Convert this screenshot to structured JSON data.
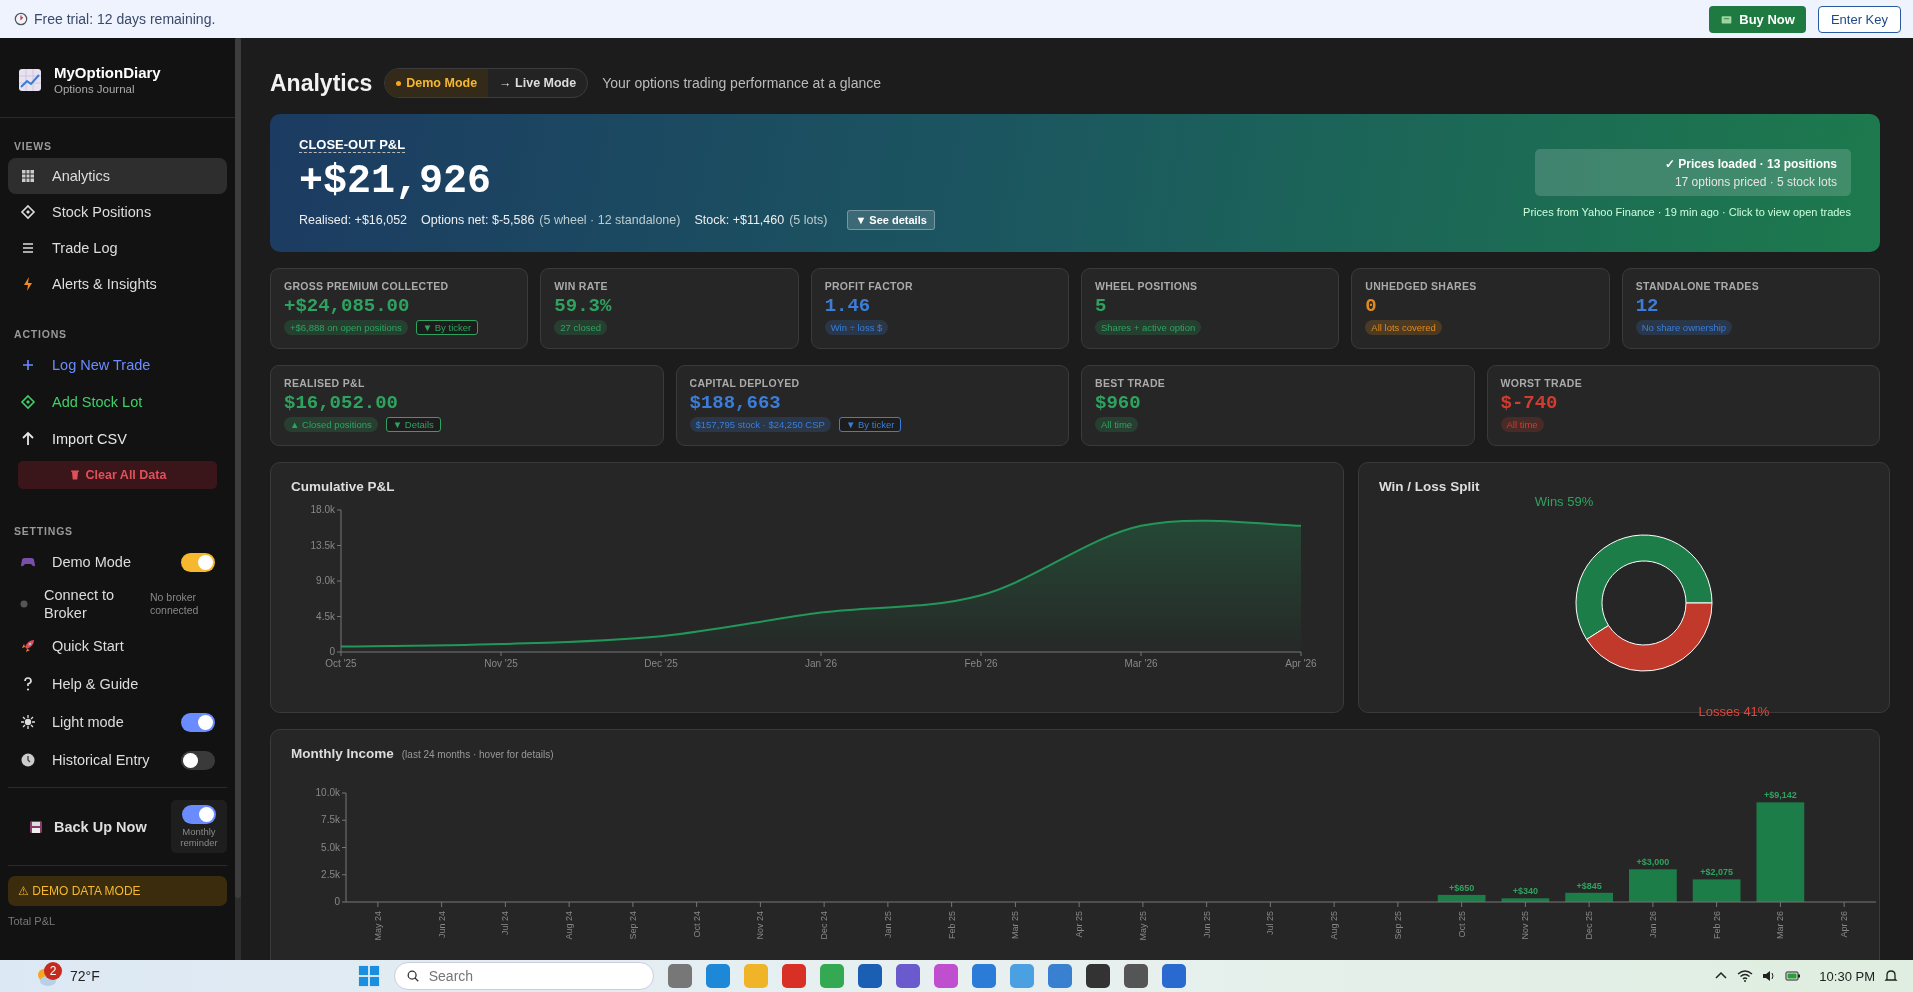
{
  "trial_banner": {
    "text": "Free trial: 12 days remaining.",
    "buttons": [
      {
        "label": "Buy Now",
        "kind": "primary"
      },
      {
        "label": "Enter Key",
        "kind": "outline"
      }
    ]
  },
  "sidebar": {
    "brand": {
      "name": "MyOptionDiary",
      "subtitle": "Options Journal"
    },
    "views": {
      "title": "VIEWS",
      "items": [
        {
          "label": "Analytics",
          "selected": true
        },
        {
          "label": "Stock Positions",
          "selected": false
        },
        {
          "label": "Trade Log",
          "selected": false
        },
        {
          "label": "Alerts & Insights",
          "selected": false
        }
      ]
    },
    "actions": {
      "title": "ACTIONS",
      "items": [
        {
          "label": "Log New Trade",
          "kind": "link",
          "color": "#6b8cff"
        },
        {
          "label": "Add Stock Lot",
          "kind": "link",
          "color": "#3fcf6a"
        },
        {
          "label": "Import CSV",
          "kind": "link",
          "color": "#e6e6e6"
        },
        {
          "label": "Clear All Data",
          "kind": "danger"
        }
      ]
    },
    "settings": {
      "title": "SETTINGS",
      "items": [
        {
          "label": "Demo Mode",
          "kind": "toggle",
          "on": true,
          "color": "#f5b82e"
        },
        {
          "label": "Connect to Broker",
          "kind": "status",
          "note": "No broker connected"
        },
        {
          "label": "Quick Start",
          "kind": "link"
        },
        {
          "label": "Help & Guide",
          "kind": "link"
        },
        {
          "label": "Light mode",
          "kind": "toggle",
          "on": true,
          "color": "#6b8cff"
        },
        {
          "label": "Historical Entry",
          "kind": "toggle",
          "on": false
        }
      ]
    },
    "backup": {
      "label": "Back Up Now",
      "reminder": {
        "label": "Monthly reminder",
        "on": true
      }
    },
    "demo_notice": "⚠ DEMO DATA MODE",
    "footer_label": "Total P&L"
  },
  "page": {
    "title": "Analytics",
    "mode_switch": [
      {
        "label": "Demo Mode",
        "selected": true
      },
      {
        "label": "→ Live Mode",
        "selected": false
      }
    ],
    "subtitle": "Your options trading performance at a glance"
  },
  "hero": {
    "label": "CLOSE-OUT P&L",
    "value": "+$21,926",
    "breakdown": [
      {
        "text": "Realised: +$16,052"
      },
      {
        "text": "Options net: $-5,586",
        "note": "(5 wheel · 12 standalone)"
      },
      {
        "text": "Stock: +$11,460",
        "note": "(5 lots)"
      }
    ],
    "details_button": "▼ See details",
    "prices": {
      "status": "✓ Prices loaded · 13 positions",
      "detail": "17 options priced · 5 stock lots",
      "source": "Prices from Yahoo Finance · 19 min ago · Click to view open trades"
    }
  },
  "cards_row_1": [
    {
      "label": "GROSS PREMIUM COLLECTED",
      "value": "+$24,085.00",
      "color": "#2ea35f",
      "tags": [
        {
          "text": "+$6,888 on open positions",
          "kind": "pill"
        },
        {
          "text": "▼ By ticker",
          "kind": "button"
        }
      ]
    },
    {
      "label": "WIN RATE",
      "value": "59.3%",
      "color": "#2ea35f",
      "tags": [
        {
          "text": "27 closed",
          "kind": "pill"
        }
      ]
    },
    {
      "label": "PROFIT FACTOR",
      "value": "1.46",
      "color": "#3b7dd8",
      "tags": [
        {
          "text": "Win ÷ loss $",
          "kind": "pill"
        }
      ]
    },
    {
      "label": "WHEEL POSITIONS",
      "value": "5",
      "color": "#2ea35f",
      "tags": [
        {
          "text": "Shares + active option",
          "kind": "pill"
        }
      ]
    },
    {
      "label": "UNHEDGED SHARES",
      "value": "0",
      "color": "#e08a1e",
      "tags": [
        {
          "text": "All lots covered",
          "kind": "pill"
        }
      ]
    },
    {
      "label": "STANDALONE TRADES",
      "value": "12",
      "color": "#3b7dd8",
      "tags": [
        {
          "text": "No share ownership",
          "kind": "pill"
        }
      ]
    }
  ],
  "cards_row_2": [
    {
      "label": "REALISED P&L",
      "value": "$16,052.00",
      "color": "#2ea35f",
      "tags": [
        {
          "text": "▲ Closed positions",
          "kind": "pill"
        },
        {
          "text": "▼ Details",
          "kind": "button"
        }
      ]
    },
    {
      "label": "CAPITAL DEPLOYED",
      "value": "$188,663",
      "color": "#3b7dd8",
      "tags": [
        {
          "text": "$157,795 stock · $24,250 CSP",
          "kind": "pill"
        },
        {
          "text": "▼ By ticker",
          "kind": "button"
        }
      ]
    },
    {
      "label": "BEST TRADE",
      "value": "$960",
      "color": "#2ea35f",
      "tags": [
        {
          "text": "All time",
          "kind": "pill"
        }
      ]
    },
    {
      "label": "WORST TRADE",
      "value": "$-740",
      "color": "#d23b2e",
      "tags": [
        {
          "text": "All time",
          "kind": "pill"
        }
      ]
    }
  ],
  "cumulative_pnl": {
    "title": "Cumulative P&L",
    "chart_data": {
      "type": "area",
      "x": [
        "Oct '25",
        "Nov '25",
        "Dec '25",
        "Jan '26",
        "Feb '26",
        "Mar '26",
        "Apr '26"
      ],
      "series": [
        {
          "color": "#23975a",
          "values": [
            700,
            1000,
            2000,
            5000,
            7200,
            16000,
            16000
          ]
        }
      ],
      "ylim": [
        0,
        18000
      ],
      "yticks": [
        {
          "value": 0,
          "label": "0"
        },
        {
          "value": 4500,
          "label": "4.5k"
        },
        {
          "value": 9000,
          "label": "9.0k"
        },
        {
          "value": 13500,
          "label": "13.5k"
        },
        {
          "value": 18000,
          "label": "18.0k"
        }
      ]
    }
  },
  "win_loss": {
    "title": "Win / Loss Split",
    "chart_data": {
      "type": "donut",
      "series": [
        {
          "values": [
            59,
            41
          ]
        }
      ],
      "colors": [
        "#1d7d48",
        "#c0392b"
      ],
      "value_labels": [
        "Wins 59%",
        "Losses 41%"
      ]
    }
  },
  "monthly_income": {
    "title": "Monthly Income",
    "note": "(last 24 months · hover for details)",
    "chart_data": {
      "type": "bar",
      "categories": [
        "May 24",
        "Jun 24",
        "Jul 24",
        "Aug 24",
        "Sep 24",
        "Oct 24",
        "Nov 24",
        "Dec 24",
        "Jan 25",
        "Feb 25",
        "Mar 25",
        "Apr 25",
        "May 25",
        "Jun 25",
        "Jul 25",
        "Aug 25",
        "Sep 25",
        "Oct 25",
        "Nov 25",
        "Dec 25",
        "Jan 26",
        "Feb 26",
        "Mar 26",
        "Apr 26"
      ],
      "series": [
        {
          "color": "#1d7d48",
          "values": [
            0,
            0,
            0,
            0,
            0,
            0,
            0,
            0,
            0,
            0,
            0,
            0,
            0,
            0,
            0,
            0,
            0,
            650,
            340,
            845,
            3000,
            2075,
            9142,
            0
          ]
        }
      ],
      "value_labels": [
        null,
        null,
        null,
        null,
        null,
        null,
        null,
        null,
        null,
        null,
        null,
        null,
        null,
        null,
        null,
        null,
        null,
        "+$650",
        "+$340",
        "+$845",
        "+$3,000",
        "+$2,075",
        "+$9,142",
        null
      ],
      "ylim": [
        0,
        10000
      ],
      "yticks": [
        {
          "value": 0,
          "label": "0"
        },
        {
          "value": 2500,
          "label": "2.5k"
        },
        {
          "value": 5000,
          "label": "5.0k"
        },
        {
          "value": 7500,
          "label": "7.5k"
        },
        {
          "value": 10000,
          "label": "10.0k"
        }
      ]
    }
  },
  "taskbar": {
    "weather": {
      "badge": "2",
      "temp": "72°F"
    },
    "search": {
      "placeholder": "Search"
    },
    "clock": "10:30 PM"
  }
}
